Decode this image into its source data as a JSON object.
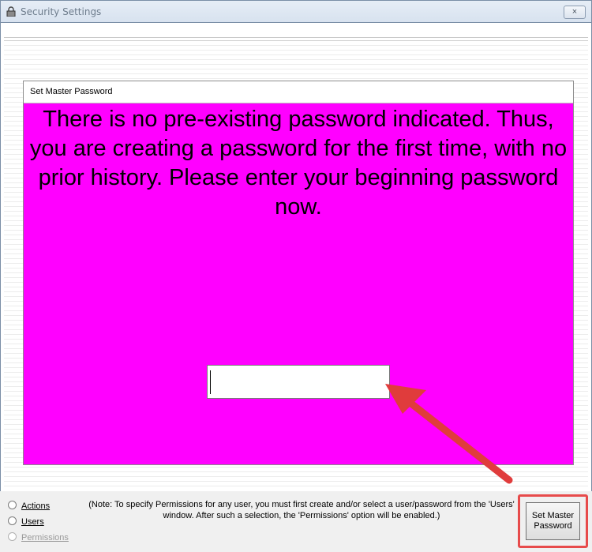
{
  "window": {
    "title": "Security Settings",
    "close_label": "×"
  },
  "panel": {
    "header": "Set Master Password",
    "message": "There is no pre-existing password indicated. Thus, you are creating a password for the first time, with no prior history.  Please enter your beginning password now.",
    "password_value": ""
  },
  "options": [
    {
      "label": "Actions",
      "enabled": true
    },
    {
      "label": "Users",
      "enabled": true
    },
    {
      "label": "Permissions",
      "enabled": false
    }
  ],
  "note": "(Note: To specify Permissions for any user, you must first create and/or select a user/password from the 'Users' window.  After such a selection, the 'Permissions' option will be enabled.)",
  "set_button": {
    "line1": "Set Master",
    "line2": "Password"
  },
  "colors": {
    "panel_bg": "#ff00ff",
    "annotation": "#e74b4b"
  }
}
